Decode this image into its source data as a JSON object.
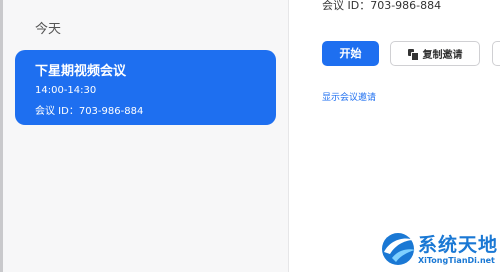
{
  "sidebar": {
    "section_label": "今天",
    "meeting": {
      "title": "下星期视频会议",
      "time": "14:00-14:30",
      "id_text": "会议 ID：703-986-884"
    }
  },
  "detail": {
    "id_text": "会议 ID：703-986-884",
    "start_label": "开始",
    "copy_label": "复制邀请",
    "show_invite_label": "显示会议邀请"
  },
  "watermark": {
    "title": "系统天地",
    "subtitle": "XiTongTianDi.net"
  },
  "colors": {
    "accent": "#1e6ff0",
    "watermark": "#1a78d4"
  }
}
